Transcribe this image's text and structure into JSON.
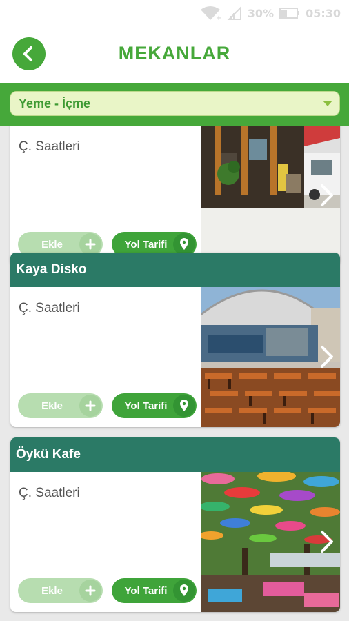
{
  "statusbar": {
    "battery": "30%",
    "time": "05:30"
  },
  "header": {
    "title": "MEKANLAR",
    "back_icon": "chevron-left-icon"
  },
  "filter": {
    "selected": "Yeme - İçme",
    "arrow_icon": "triangle-down-icon"
  },
  "places": [
    {
      "name": "",
      "hours_label": "Ç. Saatleri",
      "add_label": "Ekle",
      "route_label": "Yol Tarifi",
      "photo": "street-cafe-photo"
    },
    {
      "name": "Kaya Disko",
      "hours_label": "Ç. Saatleri",
      "add_label": "Ekle",
      "route_label": "Yol Tarifi",
      "photo": "open-air-disco-photo"
    },
    {
      "name": "Öykü Kafe",
      "hours_label": "Ç. Saatleri",
      "add_label": "Ekle",
      "route_label": "Yol Tarifi",
      "photo": "umbrella-cafe-photo"
    }
  ],
  "colors": {
    "brand_green": "#46a83a",
    "card_header": "#2b7a66",
    "select_bg": "#e9f5c7"
  }
}
